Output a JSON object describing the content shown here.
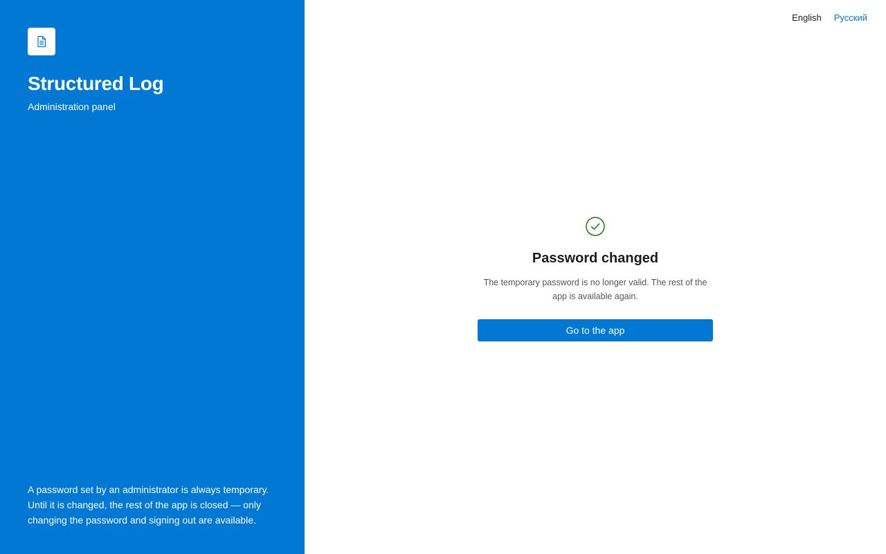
{
  "brand": {
    "logo_icon": "document-icon",
    "title": "Structured Log",
    "subtitle": "Administration panel",
    "note": "A password set by an administrator is always temporary. Until it is changed, the rest of the app is closed — only changing the password and signing out are available.",
    "background_color": "#0078d4"
  },
  "language_switcher": {
    "options": [
      {
        "label": "English",
        "active": true
      },
      {
        "label": "Русский",
        "active": false
      }
    ]
  },
  "result": {
    "icon": "check-circle-icon",
    "icon_color": "#107c10",
    "title": "Password changed",
    "message": "The temporary password is no longer valid. The rest of the app is available again.",
    "button_label": "Go to the app"
  }
}
